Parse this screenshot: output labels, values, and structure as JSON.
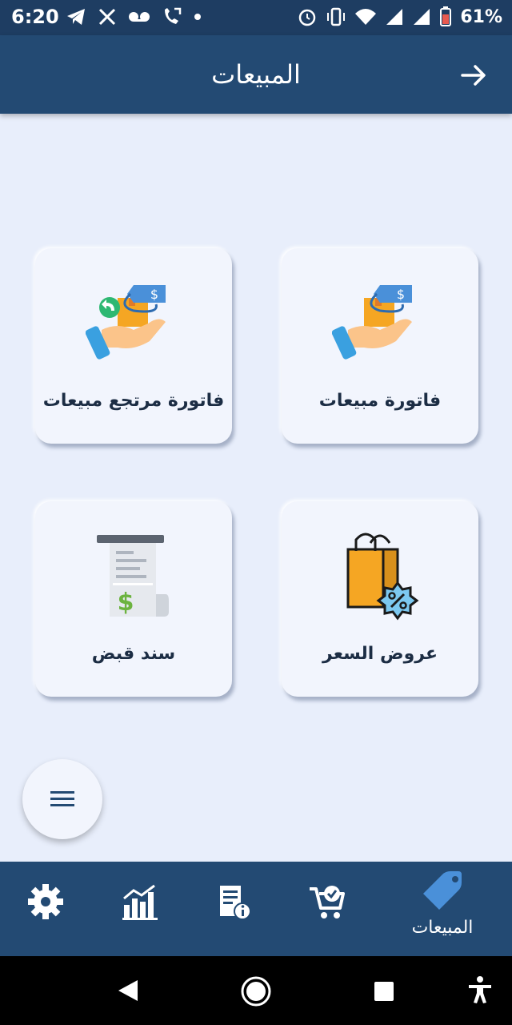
{
  "status_bar": {
    "time": "6:20",
    "battery": "61%",
    "icons_left": [
      "telegram-icon",
      "x-icon",
      "voicemail-icon",
      "call-forward-icon",
      "dot-icon"
    ],
    "icons_right": [
      "alarm-icon",
      "vibrate-icon",
      "wifi-icon",
      "signal-icon",
      "signal-icon",
      "battery-icon"
    ]
  },
  "app_bar": {
    "title": "المبيعات",
    "back_icon": "arrow-right-icon"
  },
  "tiles": [
    {
      "label": "فاتورة مبيعات",
      "icon": "hand-package-tag-icon"
    },
    {
      "label": "فاتورة مرتجع مبيعات",
      "icon": "hand-package-return-icon"
    },
    {
      "label": "عروض السعر",
      "icon": "shopping-bag-percent-icon"
    },
    {
      "label": "سند قبض",
      "icon": "receipt-dollar-icon"
    }
  ],
  "fab": {
    "icon": "menu-icon"
  },
  "bottom_nav": {
    "items": [
      {
        "label": "المبيعات",
        "icon": "tag-icon",
        "active": true
      },
      {
        "label": "",
        "icon": "cart-check-icon"
      },
      {
        "label": "",
        "icon": "report-info-icon"
      },
      {
        "label": "",
        "icon": "bar-chart-icon"
      },
      {
        "label": "",
        "icon": "gear-icon"
      }
    ]
  },
  "colors": {
    "primary": "#234a73",
    "background": "#e8eefb",
    "tile": "#f2f5fd",
    "accent_tag": "#4a90d9",
    "bag": "#f5a623"
  }
}
